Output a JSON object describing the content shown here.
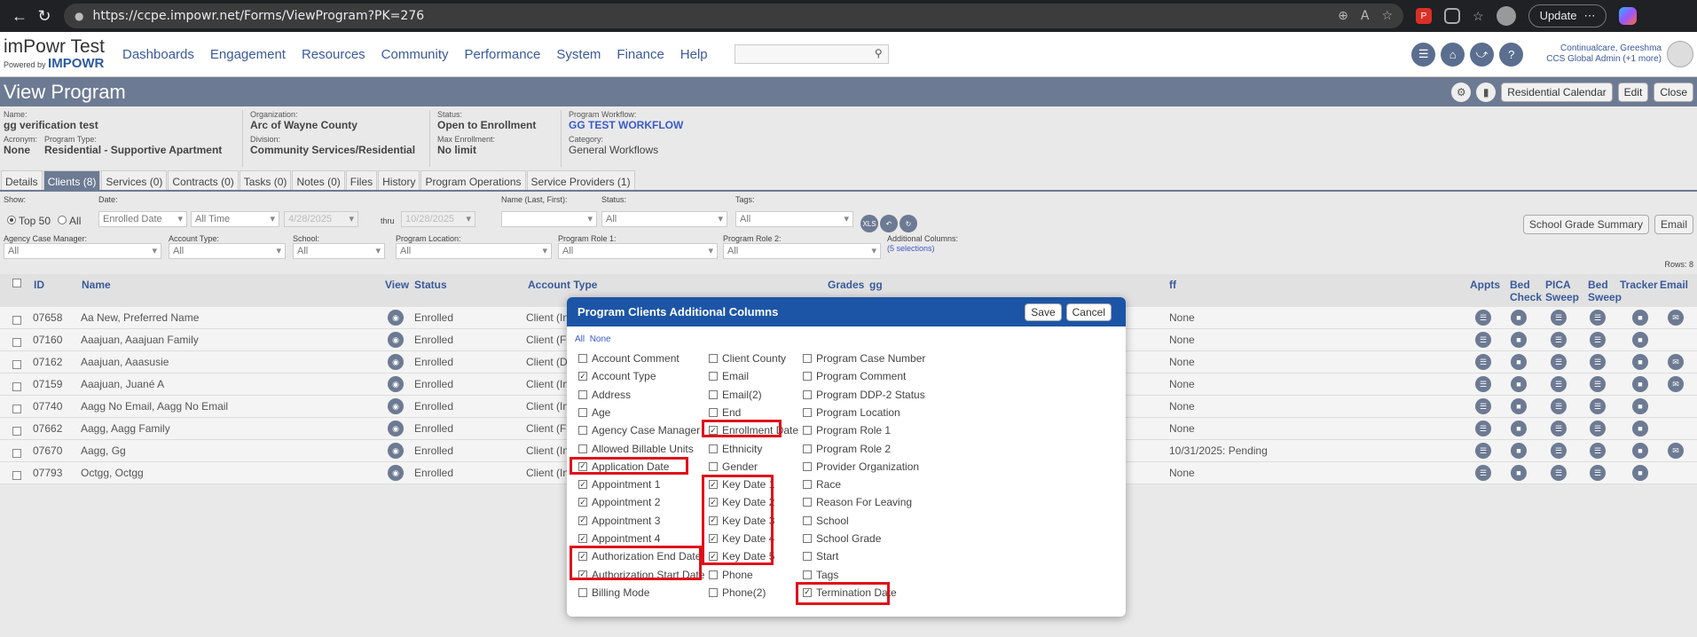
{
  "browser": {
    "url": "https://ccpe.impowr.net/Forms/ViewProgram?PK=276",
    "update_label": "Update"
  },
  "app": {
    "logo_title": "imPowr Test",
    "logo_powered": "Powered by",
    "logo_brand": "IMPOWR",
    "nav": [
      "Dashboards",
      "Engagement",
      "Resources",
      "Community",
      "Performance",
      "System",
      "Finance",
      "Help"
    ],
    "user_name": "Continualcare, Greeshma",
    "user_role": "CCS Global Admin (+1 more)"
  },
  "page": {
    "title": "View Program",
    "buttons": [
      "Residential Calendar",
      "Edit",
      "Close"
    ]
  },
  "program": {
    "name_label": "Name:",
    "name": "gg verification test",
    "acronym_label": "Acronym:",
    "acronym": "None",
    "type_label": "Program Type:",
    "type": "Residential - Supportive Apartment",
    "org_label": "Organization:",
    "org": "Arc of Wayne County",
    "division_label": "Division:",
    "division": "Community Services/Residential",
    "status_label": "Status:",
    "status": "Open to Enrollment",
    "max_label": "Max Enrollment:",
    "max": "No limit",
    "workflow_label": "Program Workflow:",
    "workflow": "GG TEST WORKFLOW",
    "category_label": "Category:",
    "category": "General Workflows"
  },
  "tabs": [
    "Details",
    "Clients (8)",
    "Services (0)",
    "Contracts (0)",
    "Tasks (0)",
    "Notes (0)",
    "Files",
    "History",
    "Program Operations",
    "Service Providers (1)"
  ],
  "filters": {
    "show_label": "Show:",
    "top50": "Top 50",
    "all": "All",
    "date_label": "Date:",
    "date_field": "Enrolled Date",
    "date_range": "All Time",
    "from": "4/28/2025",
    "thru_label": "thru",
    "to": "10/28/2025",
    "name_label": "Name (Last, First):",
    "status_label": "Status:",
    "status_value": "All",
    "tags_label": "Tags:",
    "tags_value": "All",
    "xls": "XLS",
    "acm_label": "Agency Case Manager:",
    "acm_value": "All",
    "acct_label": "Account Type:",
    "acct_value": "All",
    "school_label": "School:",
    "school_value": "All",
    "loc_label": "Program Location:",
    "loc_value": "All",
    "role1_label": "Program Role 1:",
    "role1_value": "All",
    "role2_label": "Program Role 2:",
    "role2_value": "All",
    "addcols_label": "Additional Columns:",
    "addcols_value": "(5 selections)",
    "btn_grade": "School Grade Summary",
    "btn_email": "Email",
    "rows": "Rows: 8"
  },
  "table": {
    "headers": {
      "id": "ID",
      "name": "Name",
      "view": "View",
      "status": "Status",
      "acct": "Account Type",
      "grades": "Grades",
      "gg": "gg",
      "ff": "ff",
      "appts": "Appts",
      "bed_check_1": "Bed",
      "bed_check_2": "Check",
      "pica_1": "PICA",
      "pica_2": "Sweep",
      "bed_sweep_1": "Bed",
      "bed_sweep_2": "Sweep",
      "tracker": "Tracker",
      "email": "Email"
    },
    "rows": [
      {
        "id": "07658",
        "name": "Aa New, Preferred Name",
        "status": "Enrolled",
        "acct": "Client (In",
        "ff": "None"
      },
      {
        "id": "07160",
        "name": "Aaajuan, Aaajuan Family",
        "status": "Enrolled",
        "acct": "Client (F",
        "ff": "None"
      },
      {
        "id": "07162",
        "name": "Aaajuan, Aaasusie",
        "status": "Enrolled",
        "acct": "Client (D",
        "ff": "None"
      },
      {
        "id": "07159",
        "name": "Aaajuan, Juané A",
        "status": "Enrolled",
        "acct": "Client (In",
        "ff": "None"
      },
      {
        "id": "07740",
        "name": "Aagg No Email, Aagg No Email",
        "status": "Enrolled",
        "acct": "Client (In",
        "ff": "None"
      },
      {
        "id": "07662",
        "name": "Aagg, Aagg Family",
        "status": "Enrolled",
        "acct": "Client (F",
        "ff": "None"
      },
      {
        "id": "07670",
        "name": "Aagg, Gg",
        "status": "Enrolled",
        "acct": "Client (In",
        "ff": "10/31/2025: Pending"
      },
      {
        "id": "07793",
        "name": "Octgg, Octgg",
        "status": "Enrolled",
        "acct": "Client (In",
        "ff": "None"
      }
    ]
  },
  "modal": {
    "title": "Program Clients Additional Columns",
    "save": "Save",
    "cancel": "Cancel",
    "all": "All",
    "none": "None",
    "col1": [
      {
        "label": "Account Comment",
        "checked": false
      },
      {
        "label": "Account Type",
        "checked": true
      },
      {
        "label": "Address",
        "checked": false
      },
      {
        "label": "Age",
        "checked": false
      },
      {
        "label": "Agency Case Manager",
        "checked": false
      },
      {
        "label": "Allowed Billable Units",
        "checked": false
      },
      {
        "label": "Application Date",
        "checked": true
      },
      {
        "label": "Appointment 1",
        "checked": true
      },
      {
        "label": "Appointment 2",
        "checked": true
      },
      {
        "label": "Appointment 3",
        "checked": true
      },
      {
        "label": "Appointment 4",
        "checked": true
      },
      {
        "label": "Authorization End Date",
        "checked": true
      },
      {
        "label": "Authorization Start Date",
        "checked": true
      },
      {
        "label": "Billing Mode",
        "checked": false
      }
    ],
    "col2": [
      {
        "label": "Client County",
        "checked": false
      },
      {
        "label": "Email",
        "checked": false
      },
      {
        "label": "Email(2)",
        "checked": false
      },
      {
        "label": "End",
        "checked": false
      },
      {
        "label": "Enrollment Date",
        "checked": true
      },
      {
        "label": "Ethnicity",
        "checked": false
      },
      {
        "label": "Gender",
        "checked": false
      },
      {
        "label": "Key Date 1",
        "checked": true
      },
      {
        "label": "Key Date 2",
        "checked": true
      },
      {
        "label": "Key Date 3",
        "checked": true
      },
      {
        "label": "Key Date 4",
        "checked": true
      },
      {
        "label": "Key Date 5",
        "checked": true
      },
      {
        "label": "Phone",
        "checked": false
      },
      {
        "label": "Phone(2)",
        "checked": false
      }
    ],
    "col3": [
      {
        "label": "Program Case Number",
        "checked": false
      },
      {
        "label": "Program Comment",
        "checked": false
      },
      {
        "label": "Program DDP-2 Status",
        "checked": false
      },
      {
        "label": "Program Location",
        "checked": false
      },
      {
        "label": "Program Role 1",
        "checked": false
      },
      {
        "label": "Program Role 2",
        "checked": false
      },
      {
        "label": "Provider Organization",
        "checked": false
      },
      {
        "label": "Race",
        "checked": false
      },
      {
        "label": "Reason For Leaving",
        "checked": false
      },
      {
        "label": "School",
        "checked": false
      },
      {
        "label": "School Grade",
        "checked": false
      },
      {
        "label": "Start",
        "checked": false
      },
      {
        "label": "Tags",
        "checked": false
      },
      {
        "label": "Termination Date",
        "checked": true
      }
    ]
  }
}
